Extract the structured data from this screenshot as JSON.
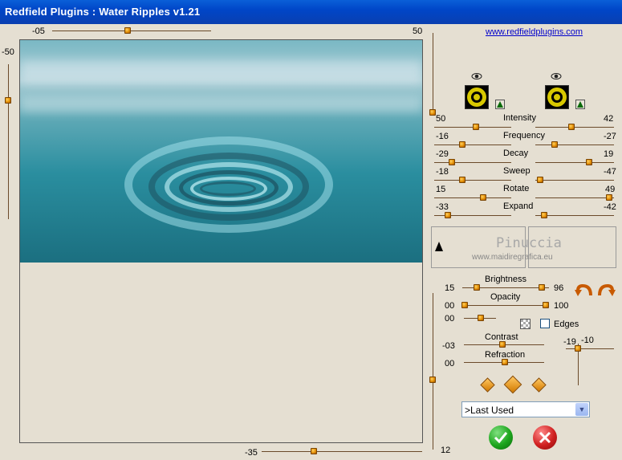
{
  "window": {
    "title": "Redfield Plugins : Water Ripples v1.21"
  },
  "link": "www.redfieldplugins.com",
  "preview_sliders": {
    "top": {
      "value": "-05",
      "fraction": 0.42
    },
    "top_right_value": "50",
    "left": {
      "value": "-50",
      "fraction": 0.25
    },
    "right_vertical_value": "50",
    "bottom": {
      "value": "-35",
      "fraction": 0.32
    },
    "bottom_right_value": "12"
  },
  "wave_params": [
    {
      "label": "Intensity",
      "left": "50",
      "right": "42",
      "lf": 0.55,
      "rf": 0.45
    },
    {
      "label": "Frequency",
      "left": "-16",
      "right": "-27",
      "lf": 0.35,
      "rf": 0.22
    },
    {
      "label": "Decay",
      "left": "-29",
      "right": "19",
      "lf": 0.2,
      "rf": 0.7
    },
    {
      "label": "Sweep",
      "left": "-18",
      "right": "-47",
      "lf": 0.35,
      "rf": 0.02
    },
    {
      "label": "Rotate",
      "left": "15",
      "right": "49",
      "lf": 0.65,
      "rf": 0.98
    },
    {
      "label": "Expand",
      "left": "-33",
      "right": "-42",
      "lf": 0.15,
      "rf": 0.08
    }
  ],
  "watermark": {
    "name": "Pinuccia",
    "site": "www.maidiregrafica.eu"
  },
  "brightness": {
    "label": "Brightness",
    "left": "15",
    "right": "96"
  },
  "opacity": {
    "label": "Opacity",
    "left": "00",
    "right": "100",
    "second": "00"
  },
  "edges_label": "Edges",
  "contrast": {
    "label": "Contrast",
    "value": "-03"
  },
  "refraction": {
    "label": "Refraction",
    "value": "00"
  },
  "light_pos": {
    "x": "-19",
    "y": "-10"
  },
  "preset": {
    "selected": ">Last Used"
  },
  "icons": {
    "eye": "eye-icon",
    "ok": "check-icon",
    "cancel": "x-icon",
    "undo": "undo-arrow-icon",
    "redo": "redo-arrow-icon"
  },
  "colors": {
    "title_bar": "#0046c8",
    "thumb": "#e08a00",
    "ok": "#1da51d",
    "cancel": "#d02020"
  }
}
